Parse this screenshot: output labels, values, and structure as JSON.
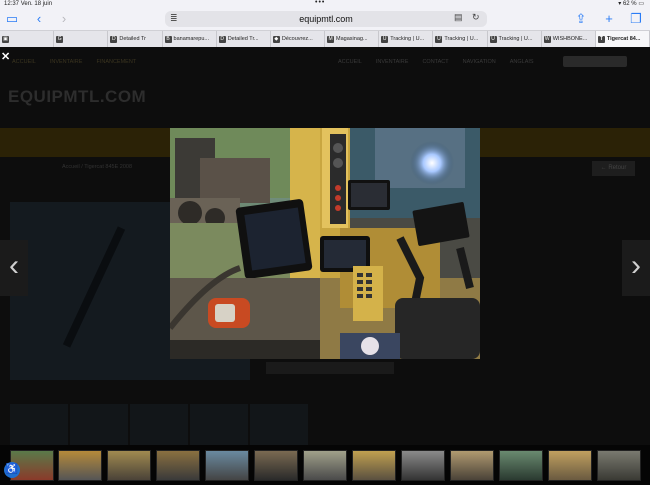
{
  "status_bar": {
    "time": "12:37",
    "date": "Ven. 18 juin",
    "battery": "62 %"
  },
  "browser": {
    "url": "equipmtl.com",
    "tabs": [
      {
        "label": "",
        "fav": "▣"
      },
      {
        "label": "",
        "fav": "G"
      },
      {
        "label": "Detailed Tr",
        "fav": "D"
      },
      {
        "label": "banamarepu...",
        "fav": "B"
      },
      {
        "label": "Detailed Tr...",
        "fav": "D"
      },
      {
        "label": "Découvrez...",
        "fav": "◆"
      },
      {
        "label": "Magasinag...",
        "fav": "M"
      },
      {
        "label": "Tracking | U...",
        "fav": "U"
      },
      {
        "label": "Tracking | U...",
        "fav": "U"
      },
      {
        "label": "Tracking | U...",
        "fav": "U"
      },
      {
        "label": "WISHBONE...",
        "fav": "W"
      },
      {
        "label": "Tigercat 84...",
        "fav": "T"
      }
    ]
  },
  "site": {
    "nav_left": [
      "ACCUEIL",
      "INVENTAIRE",
      "FINANCEMENT"
    ],
    "nav_right": [
      "ACCUEIL",
      "INVENTAIRE",
      "CONTACT",
      "NAVIGATION",
      "ANGLAIS"
    ],
    "logo": "EQUIPMTL.COM",
    "breadcrumb": "Accueil / Tigercat 845E 2008",
    "back": "Retour"
  },
  "lightbox": {
    "close": "✕",
    "prev": "‹",
    "next": "›"
  },
  "accessibility_icon": "accessibility-icon"
}
